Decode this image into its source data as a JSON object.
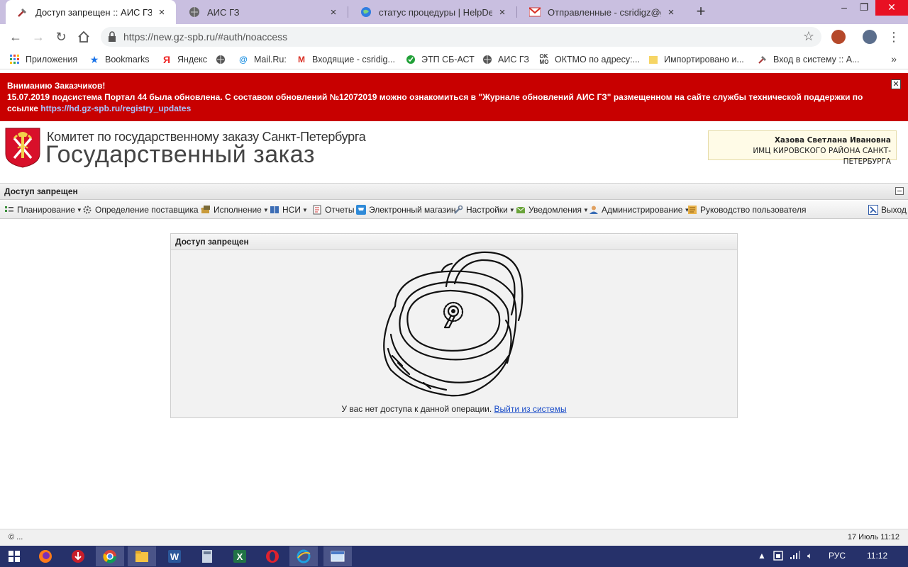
{
  "browser": {
    "tabs": [
      {
        "title": "Доступ запрещен :: АИС ГЗ",
        "active": true
      },
      {
        "title": "АИС ГЗ",
        "active": false
      },
      {
        "title": "статус процедуры | HelpDesk - о",
        "active": false
      },
      {
        "title": "Отправленные - csridigz@gmail",
        "active": false
      }
    ],
    "new_tab": "+",
    "close_glyph": "×",
    "url": "https://new.gz-spb.ru/#auth/noaccess",
    "bookmarks": [
      {
        "label": "Приложения"
      },
      {
        "label": "Bookmarks"
      },
      {
        "label": "Яндекс"
      },
      {
        "label": "Mail.Ru:"
      },
      {
        "label": "Входящие - csridig..."
      },
      {
        "label": "ЭТП СБ-АСТ"
      },
      {
        "label": "АИС ГЗ"
      },
      {
        "label": "ОКТМО по адресу:..."
      },
      {
        "label": "Импортировано и..."
      },
      {
        "label": "Вход в систему :: А..."
      }
    ],
    "bookmarks_more": "»"
  },
  "notice": {
    "heading": "Вниманию Заказчиков!",
    "text": "15.07.2019 подсистема Портал 44 была обновлена. С составом обновлений №12072019 можно ознакомиться в \"Журнале обновлений АИС ГЗ\" размещенном на сайте службы технической поддержки по ссылке",
    "link": "https://hd.gz-spb.ru/registry_updates",
    "close": "✕"
  },
  "header": {
    "org": "Комитет по государственному заказу Санкт-Петербурга",
    "system": "Государственный заказ",
    "user_name": "Хазова Светлана Ивановна",
    "user_org": "ИМЦ КИРОВСКОГО РАЙОНА САНКТ-ПЕТЕРБУРГА"
  },
  "titlebar": {
    "title": "Доступ запрещен"
  },
  "menu": [
    {
      "label": "Планирование",
      "dropdown": true
    },
    {
      "label": "Определение поставщика",
      "dropdown": true
    },
    {
      "label": "Исполнение",
      "dropdown": true
    },
    {
      "label": "НСИ",
      "dropdown": true
    },
    {
      "label": "Отчеты",
      "dropdown": false
    },
    {
      "label": "Электронный магазин",
      "dropdown": false
    },
    {
      "label": "Настройки",
      "dropdown": true
    },
    {
      "label": "Уведомления",
      "dropdown": true
    },
    {
      "label": "Администрирование",
      "dropdown": true
    },
    {
      "label": "Руководство пользователя",
      "dropdown": false
    }
  ],
  "logout_label": "Выход",
  "panel": {
    "title": "Доступ запрещен",
    "message": "У вас нет доступа к данной операции.",
    "logout_link": "Выйти из системы"
  },
  "footer": {
    "copyright": "© ...",
    "timestamp": "17 Июль 11:12"
  },
  "taskbar": {
    "lang": "РУС",
    "time": "11:12"
  },
  "colors": {
    "notice_bg": "#c80000",
    "tabstrip_bg": "#c9bfe0",
    "taskbar_bg": "#26316a",
    "link": "#1a4cc8"
  }
}
